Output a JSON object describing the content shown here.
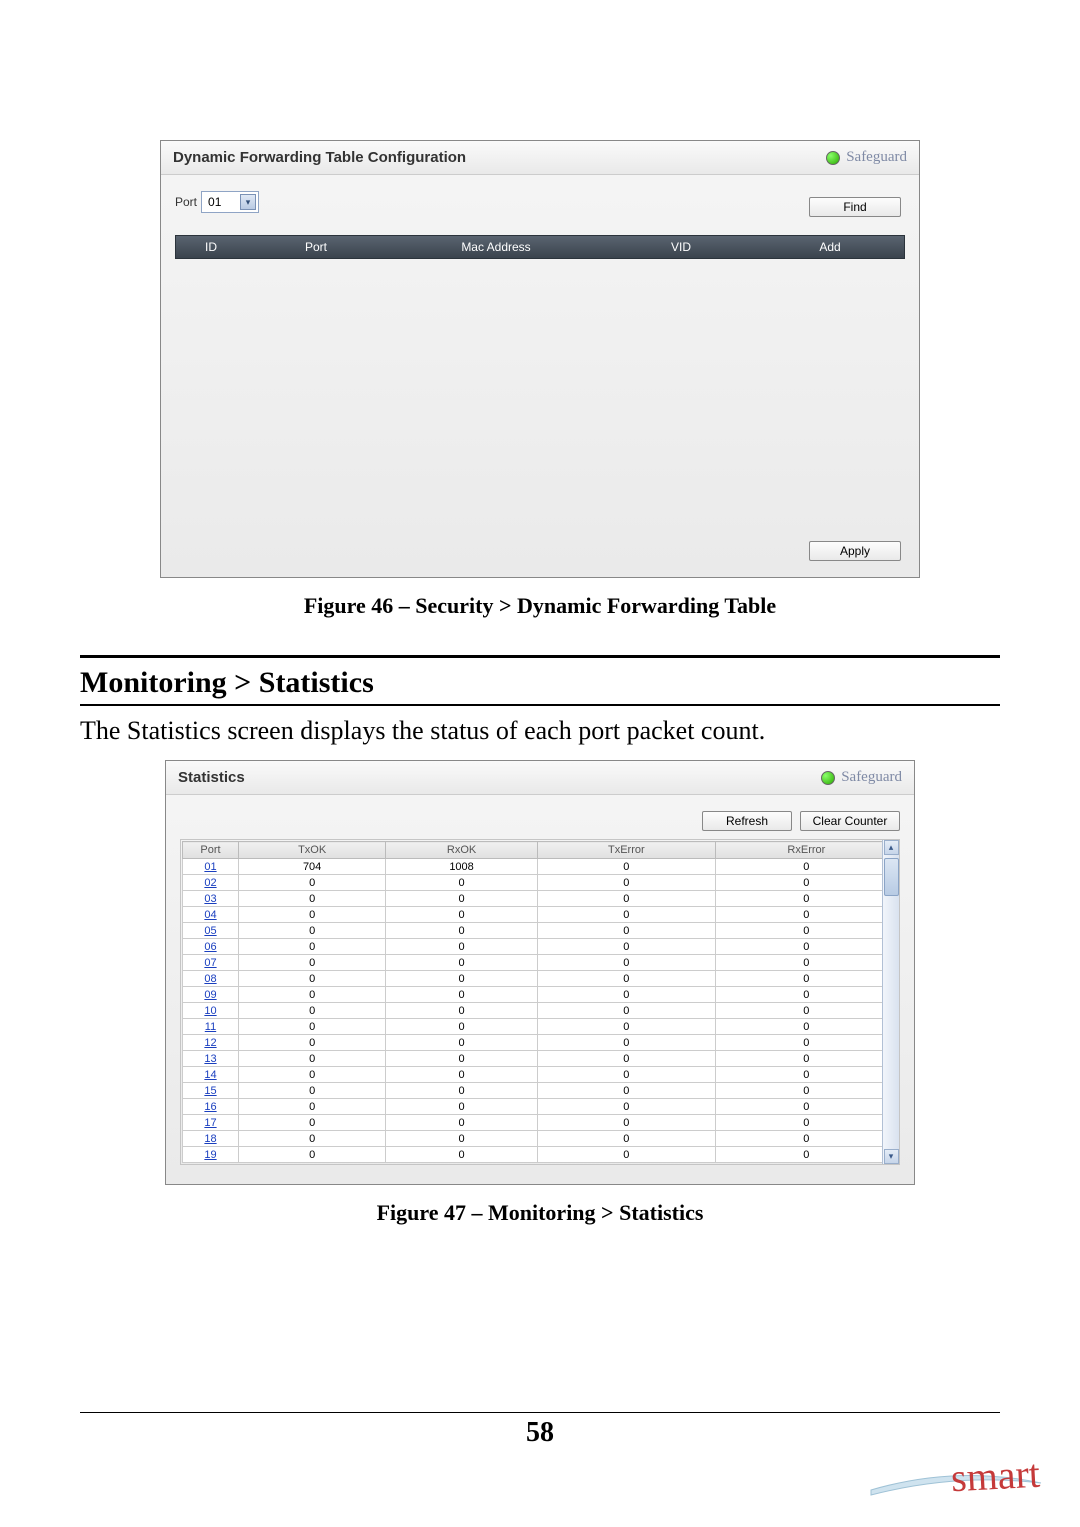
{
  "screenshot1": {
    "title": "Dynamic Forwarding Table Configuration",
    "safeguard_label": "Safeguard",
    "port_label": "Port",
    "port_value": "01",
    "find_label": "Find",
    "apply_label": "Apply",
    "columns": {
      "id": "ID",
      "port": "Port",
      "mac": "Mac Address",
      "vid": "VID",
      "add": "Add"
    }
  },
  "caption1": "Figure 46 – Security > Dynamic Forwarding Table",
  "section_heading": "Monitoring > Statistics",
  "body_text": "The Statistics screen displays the status of each port packet count.",
  "screenshot2": {
    "title": "Statistics",
    "safeguard_label": "Safeguard",
    "refresh_label": "Refresh",
    "clear_label": "Clear Counter",
    "columns": {
      "port": "Port",
      "txok": "TxOK",
      "rxok": "RxOK",
      "txerr": "TxError",
      "rxerr": "RxError"
    },
    "rows": [
      {
        "port": "01",
        "txok": "704",
        "rxok": "1008",
        "txerr": "0",
        "rxerr": "0"
      },
      {
        "port": "02",
        "txok": "0",
        "rxok": "0",
        "txerr": "0",
        "rxerr": "0"
      },
      {
        "port": "03",
        "txok": "0",
        "rxok": "0",
        "txerr": "0",
        "rxerr": "0"
      },
      {
        "port": "04",
        "txok": "0",
        "rxok": "0",
        "txerr": "0",
        "rxerr": "0"
      },
      {
        "port": "05",
        "txok": "0",
        "rxok": "0",
        "txerr": "0",
        "rxerr": "0"
      },
      {
        "port": "06",
        "txok": "0",
        "rxok": "0",
        "txerr": "0",
        "rxerr": "0"
      },
      {
        "port": "07",
        "txok": "0",
        "rxok": "0",
        "txerr": "0",
        "rxerr": "0"
      },
      {
        "port": "08",
        "txok": "0",
        "rxok": "0",
        "txerr": "0",
        "rxerr": "0"
      },
      {
        "port": "09",
        "txok": "0",
        "rxok": "0",
        "txerr": "0",
        "rxerr": "0"
      },
      {
        "port": "10",
        "txok": "0",
        "rxok": "0",
        "txerr": "0",
        "rxerr": "0"
      },
      {
        "port": "11",
        "txok": "0",
        "rxok": "0",
        "txerr": "0",
        "rxerr": "0"
      },
      {
        "port": "12",
        "txok": "0",
        "rxok": "0",
        "txerr": "0",
        "rxerr": "0"
      },
      {
        "port": "13",
        "txok": "0",
        "rxok": "0",
        "txerr": "0",
        "rxerr": "0"
      },
      {
        "port": "14",
        "txok": "0",
        "rxok": "0",
        "txerr": "0",
        "rxerr": "0"
      },
      {
        "port": "15",
        "txok": "0",
        "rxok": "0",
        "txerr": "0",
        "rxerr": "0"
      },
      {
        "port": "16",
        "txok": "0",
        "rxok": "0",
        "txerr": "0",
        "rxerr": "0"
      },
      {
        "port": "17",
        "txok": "0",
        "rxok": "0",
        "txerr": "0",
        "rxerr": "0"
      },
      {
        "port": "18",
        "txok": "0",
        "rxok": "0",
        "txerr": "0",
        "rxerr": "0"
      },
      {
        "port": "19",
        "txok": "0",
        "rxok": "0",
        "txerr": "0",
        "rxerr": "0"
      }
    ]
  },
  "caption2": "Figure 47 – Monitoring > Statistics",
  "page_number": "58",
  "logo_text": "smart"
}
